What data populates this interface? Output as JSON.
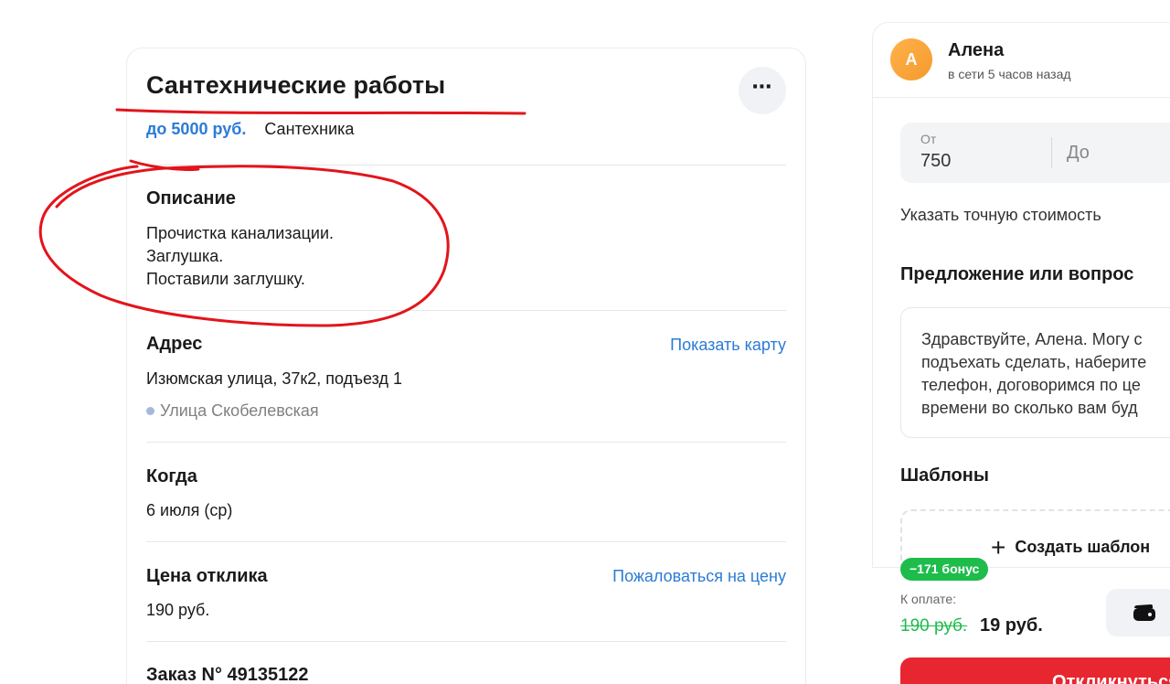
{
  "task": {
    "title": "Сантехнические работы",
    "price": "до 5000 руб.",
    "category": "Сантехника",
    "menu_icon": "⋯"
  },
  "description": {
    "heading": "Описание",
    "lines": [
      "Прочистка канализации.",
      "Заглушка.",
      "Поставили заглушку."
    ]
  },
  "address": {
    "heading": "Адрес",
    "show_map": "Показать карту",
    "value": "Изюмская улица, 37к2, подъезд 1",
    "metro": "Улица Скобелевская"
  },
  "when": {
    "heading": "Когда",
    "value": "6 июля (ср)"
  },
  "response_price": {
    "heading": "Цена отклика",
    "complain": "Пожаловаться на цену",
    "value": "190 руб."
  },
  "order": {
    "label": "Заказ N° 49135122"
  },
  "user": {
    "initial": "А",
    "name": "Алена",
    "status": "в сети 5 часов назад"
  },
  "price_range": {
    "from_label": "От",
    "from_value": "750",
    "to_placeholder": "До"
  },
  "exact_price_link": "Указать точную стоимость",
  "offer": {
    "heading": "Предложение или вопрос",
    "text": "Здравствуйте, Алена. Могу с\nподъехать сделать, наберите\nтелефон, договоримся по це\nвремени во сколько вам буд"
  },
  "templates": {
    "heading": "Шаблоны",
    "create": "Создать шаблон"
  },
  "payment": {
    "bonus": "−171 бонус",
    "label": "К оплате:",
    "old_price": "190 руб.",
    "new_price": "19 руб.",
    "respond": "Откликнуться"
  },
  "colors": {
    "link": "#2b7bd6",
    "annotation": "#e3141b",
    "bonus": "#1ebc4b",
    "respond": "#e8262f",
    "avatar": "#f59a2d"
  }
}
